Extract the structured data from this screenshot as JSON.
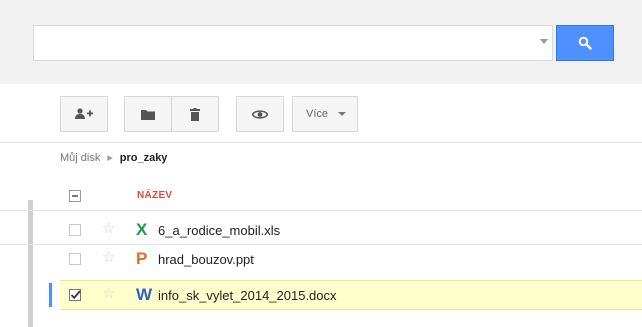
{
  "search": {
    "value": "",
    "placeholder": ""
  },
  "toolbar": {
    "add_user_icon": "add-person-icon",
    "folder_icon": "folder-icon",
    "trash_icon": "trash-icon",
    "preview_icon": "eye-icon",
    "more_label": "Více"
  },
  "breadcrumb": {
    "root": "Můj disk",
    "current": "pro_zaky"
  },
  "list": {
    "header_label": "NÁZEV",
    "files": [
      {
        "name": "6_a_rodice_mobil.xls",
        "icon": "X",
        "icon_name": "spreadsheet-icon",
        "color": "#1e9c4a",
        "selected": false
      },
      {
        "name": "hrad_bouzov.ppt",
        "icon": "P",
        "icon_name": "presentation-icon",
        "color": "#e5692b",
        "selected": false
      },
      {
        "name": "info_sk_vylet_2014_2015.docx",
        "icon": "W",
        "icon_name": "document-icon",
        "color": "#2b63c6",
        "selected": true
      }
    ]
  },
  "colors": {
    "accent_blue": "#4d90fe",
    "header_red": "#dd4b39",
    "selected_row": "#ffffcc"
  }
}
